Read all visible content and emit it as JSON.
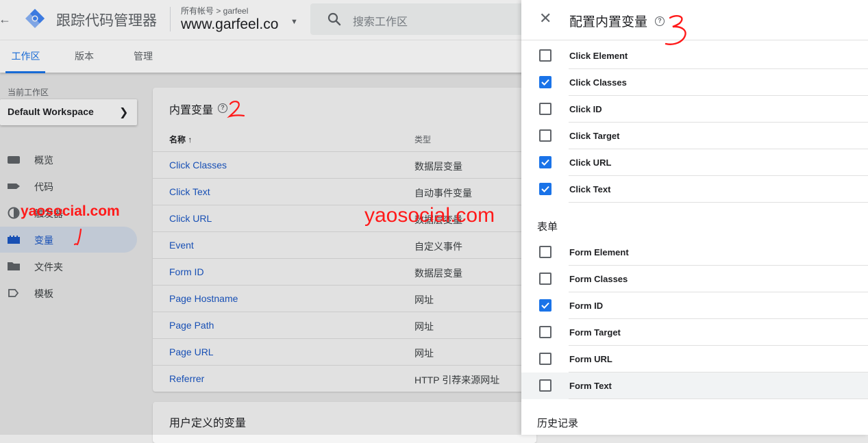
{
  "app": {
    "title": "跟踪代码管理器",
    "account_crumb": "所有帐号 > garfeel",
    "container_name": "www.garfeel.co"
  },
  "search": {
    "placeholder": "搜索工作区"
  },
  "tabs": [
    {
      "label": "工作区",
      "active": true
    },
    {
      "label": "版本",
      "active": false
    },
    {
      "label": "管理",
      "active": false
    }
  ],
  "sidebar": {
    "workspace_label": "当前工作区",
    "workspace_name": "Default Workspace",
    "items": [
      {
        "label": "概览",
        "icon": "folder-tab-icon",
        "active": false
      },
      {
        "label": "代码",
        "icon": "tag-icon",
        "active": false
      },
      {
        "label": "触发器",
        "icon": "trigger-icon",
        "active": false
      },
      {
        "label": "变量",
        "icon": "variables-icon",
        "active": true
      },
      {
        "label": "文件夹",
        "icon": "folder-icon",
        "active": false
      },
      {
        "label": "模板",
        "icon": "template-icon",
        "active": false
      }
    ]
  },
  "builtin_vars": {
    "title": "内置变量",
    "col_name": "名称 ↑",
    "col_type": "类型",
    "rows": [
      {
        "name": "Click Classes",
        "type": "数据层变量"
      },
      {
        "name": "Click Text",
        "type": "自动事件变量"
      },
      {
        "name": "Click URL",
        "type": "数据层变量"
      },
      {
        "name": "Event",
        "type": "自定义事件"
      },
      {
        "name": "Form ID",
        "type": "数据层变量"
      },
      {
        "name": "Page Hostname",
        "type": "网址"
      },
      {
        "name": "Page Path",
        "type": "网址"
      },
      {
        "name": "Page URL",
        "type": "网址"
      },
      {
        "name": "Referrer",
        "type": "HTTP 引荐来源网址"
      }
    ]
  },
  "user_vars": {
    "title": "用户定义的变量"
  },
  "panel": {
    "title": "配置内置变量",
    "click_items": [
      {
        "label": "Click Element",
        "checked": false
      },
      {
        "label": "Click Classes",
        "checked": true
      },
      {
        "label": "Click ID",
        "checked": false
      },
      {
        "label": "Click Target",
        "checked": false
      },
      {
        "label": "Click URL",
        "checked": true
      },
      {
        "label": "Click Text",
        "checked": true
      }
    ],
    "form_section": "表单",
    "form_items": [
      {
        "label": "Form Element",
        "checked": false
      },
      {
        "label": "Form Classes",
        "checked": false
      },
      {
        "label": "Form ID",
        "checked": true
      },
      {
        "label": "Form Target",
        "checked": false
      },
      {
        "label": "Form URL",
        "checked": false
      },
      {
        "label": "Form Text",
        "checked": false
      }
    ],
    "history_section": "历史记录"
  },
  "watermarks": [
    "yaosocial.com",
    "yaosocial.com"
  ],
  "colors": {
    "accent": "#1a73e8",
    "link": "#1a56c4",
    "annotation": "#ff1a1a"
  }
}
